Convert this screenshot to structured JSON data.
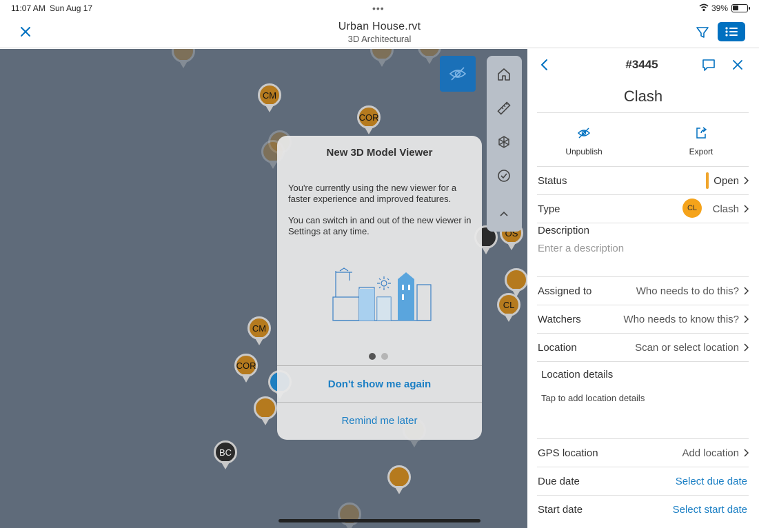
{
  "status_bar": {
    "time": "11:07 AM",
    "date": "Sun Aug 17",
    "battery": "39%"
  },
  "header": {
    "title": "Urban House.rvt",
    "subtitle": "3D Architectural"
  },
  "viewer": {
    "pins": [
      {
        "label": "CM",
        "color": "orange"
      },
      {
        "label": "COR",
        "color": "orange"
      },
      {
        "label": "CM",
        "color": "orange"
      },
      {
        "label": "COR",
        "color": "orange"
      },
      {
        "label": "BC",
        "color": "dark"
      },
      {
        "label": "CL",
        "color": "orange"
      },
      {
        "label": "OS",
        "color": "orange"
      },
      {
        "label": "COR",
        "color": "orange"
      }
    ]
  },
  "modal": {
    "title": "New 3D Model Viewer",
    "para1": "You're currently using the new viewer for a faster experience and improved features.",
    "para2": "You can switch in and out of the new viewer in Settings at any time.",
    "primary_button": "Don't show me again",
    "secondary_button": "Remind me later"
  },
  "panel": {
    "number": "#3445",
    "heading": "Clash",
    "actions": {
      "unpublish": "Unpublish",
      "export": "Export"
    },
    "status": {
      "label": "Status",
      "value": "Open"
    },
    "type": {
      "label": "Type",
      "badge": "CL",
      "value": "Clash"
    },
    "description": {
      "label": "Description",
      "placeholder": "Enter a description"
    },
    "assigned": {
      "label": "Assigned to",
      "value": "Who needs to do this?"
    },
    "watchers": {
      "label": "Watchers",
      "value": "Who needs to know this?"
    },
    "location": {
      "label": "Location",
      "value": "Scan or select location"
    },
    "location_details": {
      "label": "Location details",
      "placeholder": "Tap to add location details"
    },
    "gps": {
      "label": "GPS location",
      "value": "Add location"
    },
    "due": {
      "label": "Due date",
      "value": "Select due date"
    },
    "start": {
      "label": "Start date",
      "value": "Select start date"
    }
  },
  "colors": {
    "accent": "#0070c0",
    "status_open": "#f0a52c",
    "type_badge": "#f5a31a",
    "viewer_bg": "#5f6b7a"
  }
}
